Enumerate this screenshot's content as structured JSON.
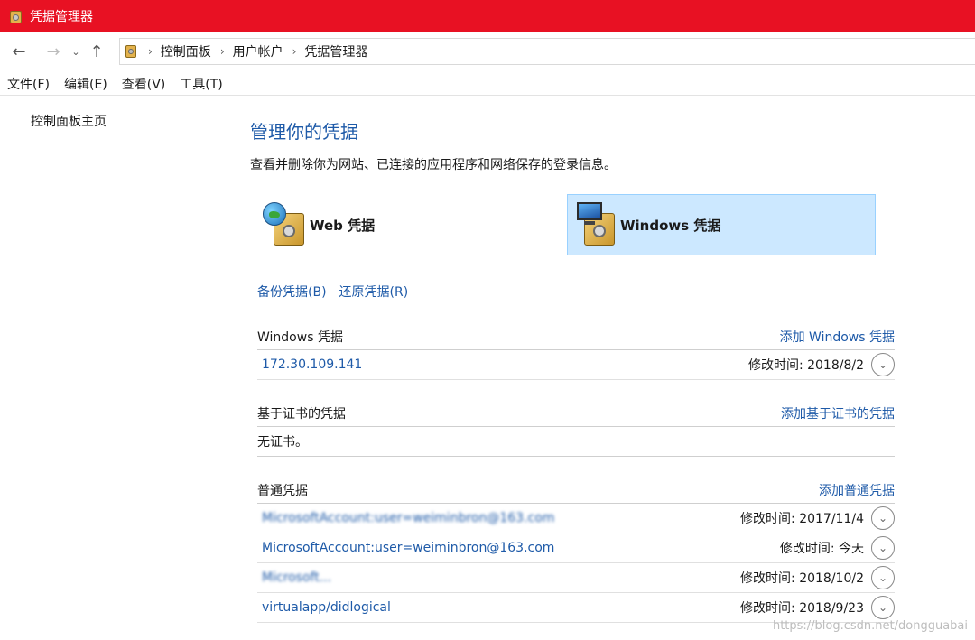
{
  "window": {
    "title": "凭据管理器"
  },
  "address": {
    "breadcrumbs": [
      "控制面板",
      "用户帐户",
      "凭据管理器"
    ]
  },
  "menu": [
    "文件(F)",
    "编辑(E)",
    "查看(V)",
    "工具(T)"
  ],
  "sidebar": {
    "home_link": "控制面板主页"
  },
  "main": {
    "title": "管理你的凭据",
    "description": "查看并删除你为网站、已连接的应用程序和网络保存的登录信息。",
    "tiles": {
      "web_label": "Web 凭据",
      "windows_label": "Windows 凭据"
    },
    "links": {
      "backup": "备份凭据(B)",
      "restore": "还原凭据(R)"
    }
  },
  "sections": {
    "windows": {
      "title": "Windows 凭据",
      "add": "添加 Windows 凭据",
      "rows": [
        {
          "name": "172.30.109.141",
          "modified": "修改时间:  2018/8/2"
        }
      ]
    },
    "certificate": {
      "title": "基于证书的凭据",
      "add": "添加基于证书的凭据",
      "empty": "无证书。"
    },
    "generic": {
      "title": "普通凭据",
      "add": "添加普通凭据",
      "rows": [
        {
          "name": "MicrosoftAccount:user=weiminbron@163.com",
          "modified": "修改时间:  2017/11/4"
        },
        {
          "name": "MicrosoftAccount:user=weiminbron@163.com",
          "modified": "修改时间:  今天"
        },
        {
          "name": "Microsoft...",
          "modified": "修改时间:  2018/10/2"
        },
        {
          "name": "virtualapp/didlogical",
          "modified": "修改时间:  2018/9/23"
        }
      ]
    }
  },
  "watermark": "https://blog.csdn.net/dongguabai",
  "colors": {
    "titlebar": "#e81123",
    "link": "#1e5aa8",
    "selected_tile": "#cce8ff"
  }
}
